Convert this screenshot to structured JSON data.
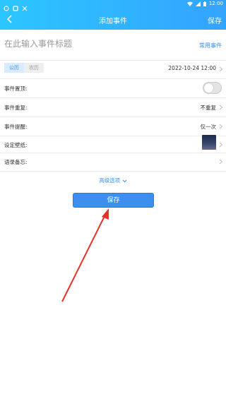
{
  "status_bar": {
    "time": "12:00"
  },
  "header": {
    "title": "添加事件",
    "save_label": "保存"
  },
  "title_field": {
    "placeholder": "在此输入事件标题",
    "common_events_link": "常用事件"
  },
  "calendar": {
    "solar_label": "公历",
    "lunar_label": "农历",
    "selected": "公历",
    "datetime": "2022-10-24  12:00"
  },
  "settings": {
    "pin": {
      "label": "事件置顶:",
      "on": false
    },
    "repeat": {
      "label": "事件重复:",
      "value": "不重复"
    },
    "reminder": {
      "label": "事件提醒:",
      "value": "仅一次"
    },
    "wallpaper": {
      "label": "设定壁纸:"
    },
    "memo": {
      "label": "语录备忘:"
    }
  },
  "advanced_label": "高级选项",
  "save_button_label": "保存",
  "colors": {
    "accent": "#3e8ef0",
    "header_start": "#2cc6ff",
    "header_end": "#34a3ff",
    "annotation_arrow": "#e5332a"
  },
  "icons": [
    "back-arrow-icon",
    "chevron-right-icon",
    "chevron-down-icon",
    "wifi-icon",
    "signal-icon",
    "battery-icon"
  ]
}
